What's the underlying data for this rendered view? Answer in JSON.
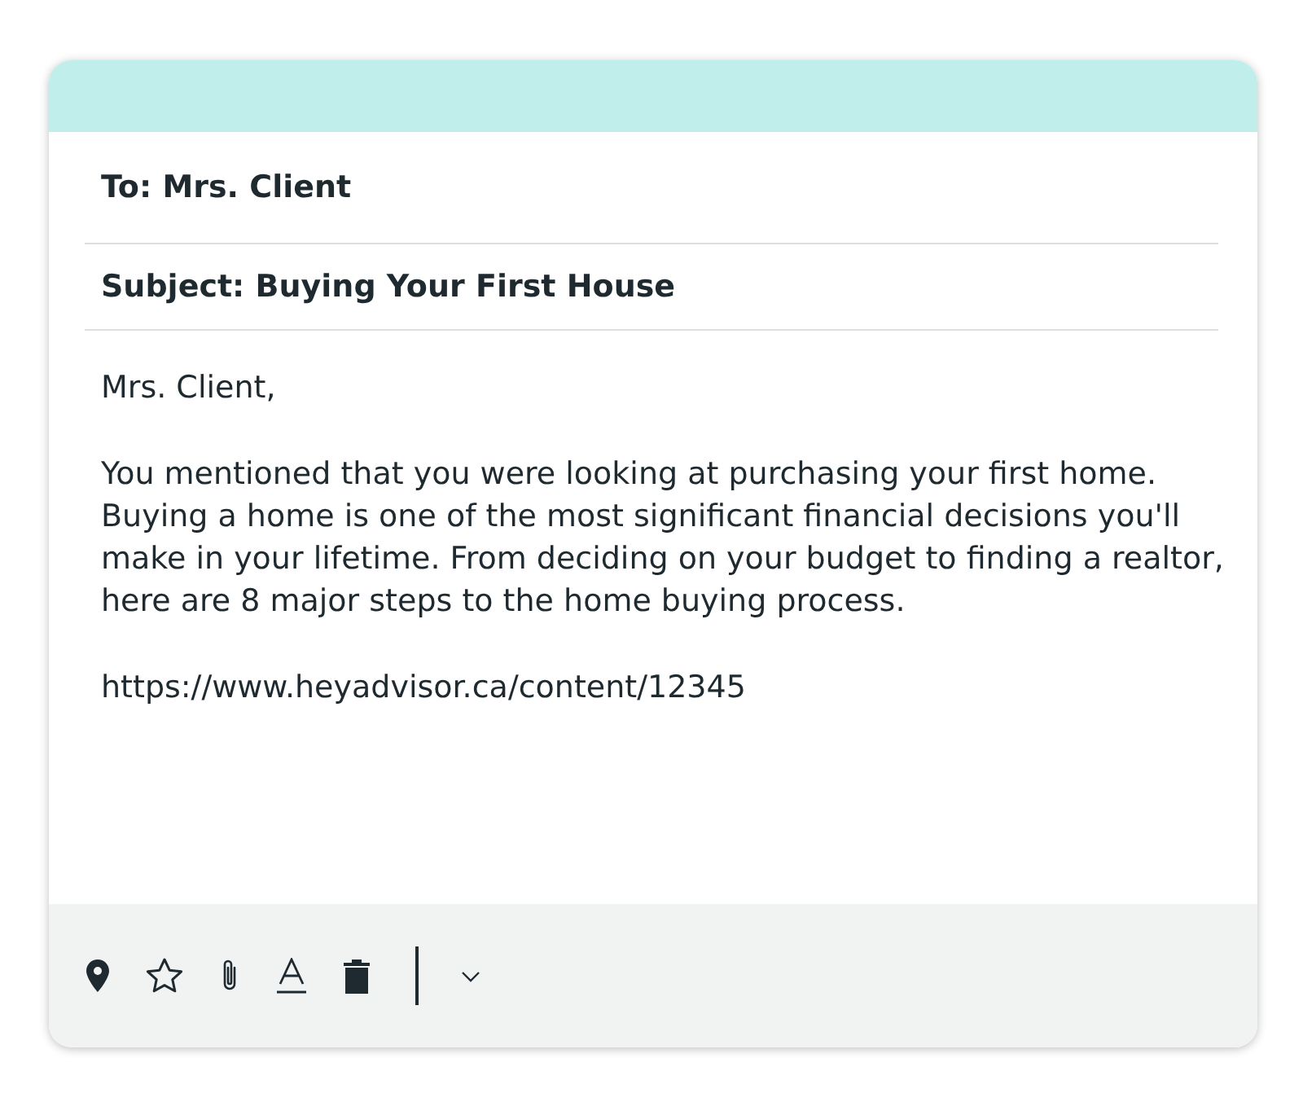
{
  "email": {
    "to": "To: Mrs. Client",
    "subject": "Subject: Buying Your First House",
    "body": [
      "Mrs. Client,",
      "You mentioned that you were looking at purchasing your first home. Buying a home is one of the most significant financial decisions you'll make in your lifetime. From deciding on your budget to finding a realtor, here are 8 major steps to the home buying process.",
      "https://www.heyadvisor.ca/content/12345"
    ]
  }
}
